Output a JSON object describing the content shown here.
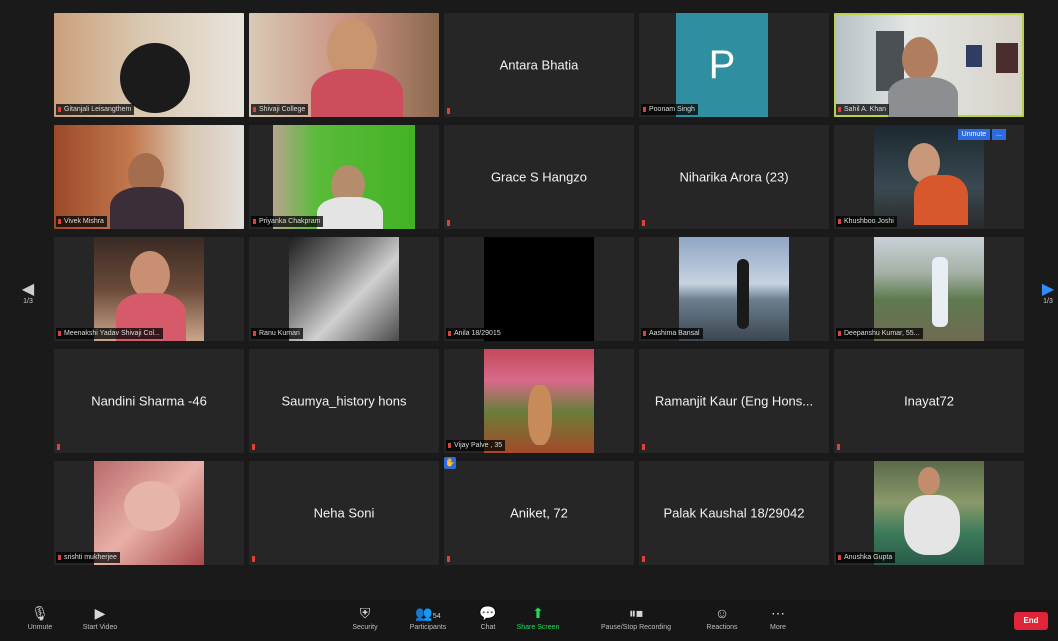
{
  "gallery": {
    "page_left": "1/3",
    "page_right": "1/3",
    "tiles": [
      {
        "label": "Gitanjali Leisangthem"
      },
      {
        "label": "Shivaji College"
      },
      {
        "name": "Antara Bhatia"
      },
      {
        "avatar_letter": "P",
        "label": "Poonam Singh"
      },
      {
        "label": "Sahil A. Khan"
      },
      {
        "label": "Vivek Mishra"
      },
      {
        "label": "Priyanka Chakpram"
      },
      {
        "name": "Grace S Hangzo"
      },
      {
        "name": "Niharika Arora  (23)"
      },
      {
        "label": "Khushboo Joshi",
        "unmute": "Unmute",
        "more": "..."
      },
      {
        "label": "Meenakshi Yadav Shivaji Col..."
      },
      {
        "label": "Ranu Kumari"
      },
      {
        "label": "Anila 18/29015"
      },
      {
        "label": "Aashima Bansal"
      },
      {
        "label": "Deepanshu Kumar, 55..."
      },
      {
        "name": "Nandini Sharma -46"
      },
      {
        "name": "Saumya_history hons"
      },
      {
        "label": "Vijay Palve , 35"
      },
      {
        "name": "Ramanjit Kaur (Eng Hons..."
      },
      {
        "name": "Inayat72"
      },
      {
        "label": "srishti mukherjee"
      },
      {
        "name": "Neha Soni"
      },
      {
        "name": "Aniket, 72"
      },
      {
        "name": "Palak Kaushal 18/29042"
      },
      {
        "label": "Anushka Gupta"
      }
    ]
  },
  "toolbar": {
    "unmute": "Unmute",
    "start_video": "Start Video",
    "security": "Security",
    "participants": "Participants",
    "participants_count": "54",
    "chat": "Chat",
    "share_screen": "Share Screen",
    "recording": "Pause/Stop Recording",
    "reactions": "Reactions",
    "more": "More",
    "end": "End"
  },
  "colors": {
    "active_speaker": "#b8d24a",
    "share_green": "#23d959",
    "end_red": "#e0243a",
    "avatar_teal": "#2f8ea0"
  }
}
